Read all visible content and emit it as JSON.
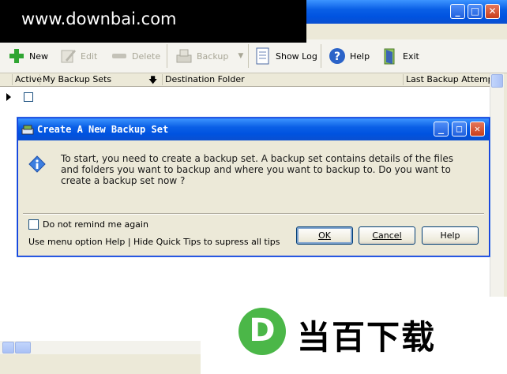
{
  "watermark": {
    "site": "www.downbai.com"
  },
  "window": {
    "controls": {
      "minimize": "_",
      "maximize": "□",
      "close": "✕"
    }
  },
  "toolbar": {
    "new": "New",
    "edit": "Edit",
    "delete": "Delete",
    "backup": "Backup",
    "show_log": "Show Log",
    "help": "Help",
    "exit": "Exit"
  },
  "grid": {
    "columns": [
      "Active",
      "My Backup Sets",
      "Destination Folder",
      "Last Backup Attempt"
    ],
    "rows": [
      {
        "active": false
      }
    ]
  },
  "dialog": {
    "title": "Create A New Backup Set",
    "message": "To start, you need to create a backup set. A backup set contains details of the files and folders you want to backup and where you want to backup to. Do you want to create a backup set now ?",
    "dont_remind": "Do not remind me again",
    "tip": "Use menu option Help |  Hide Quick Tips to supress all tips",
    "ok": "OK",
    "cancel": "Cancel",
    "help": "Help",
    "controls": {
      "minimize": "_",
      "maximize": "□",
      "close": "✕"
    }
  },
  "logo": {
    "letter": "D",
    "text": "当百下载"
  },
  "colors": {
    "titlebar": "#0a5fe6",
    "logo_green": "#4bb748",
    "new_icon": "#2fa532"
  }
}
